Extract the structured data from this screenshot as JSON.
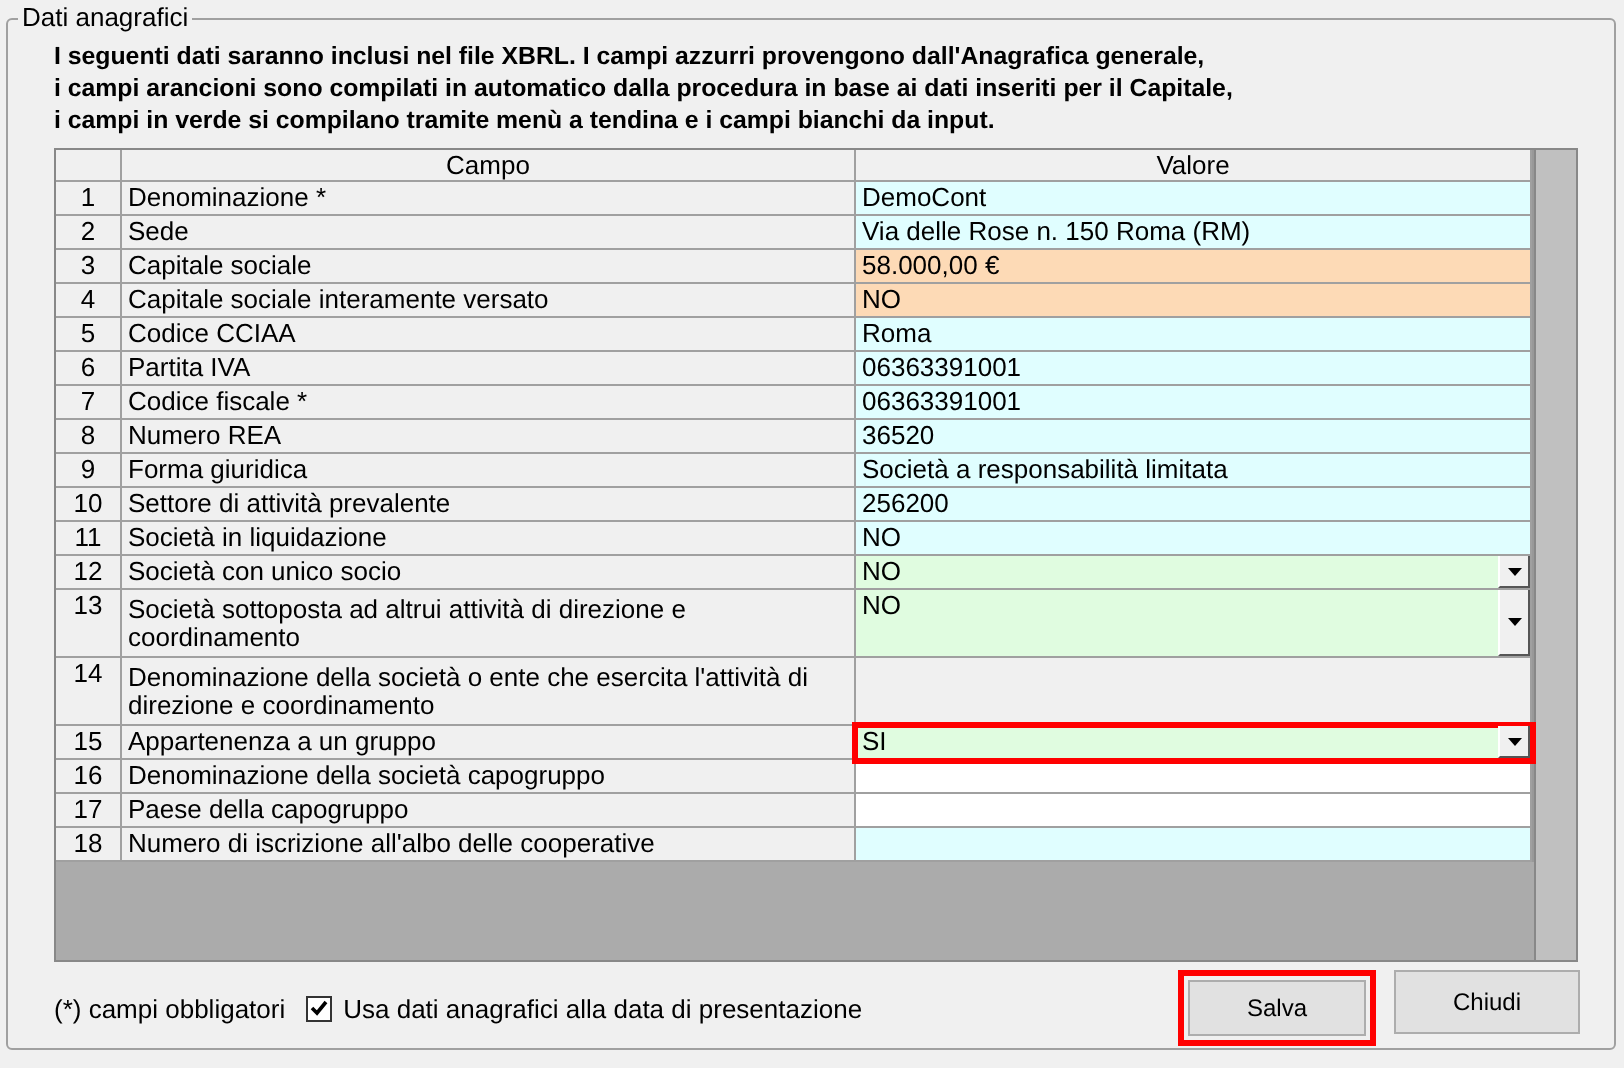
{
  "group_title": "Dati anagrafici",
  "intro": "I seguenti dati saranno inclusi nel file XBRL. I campi azzurri provengono dall'Anagrafica generale,\ni campi arancioni sono compilati in automatico dalla procedura in base ai dati inseriti per il Capitale,\ni campi in verde si compilano tramite menù a tendina e i campi bianchi da input.",
  "table": {
    "columns": [
      "Campo",
      "Valore"
    ],
    "rows": [
      {
        "number": "1",
        "field": "Denominazione *",
        "value": "DemoCont",
        "kind": "anagrafica",
        "highlighted": false
      },
      {
        "number": "2",
        "field": "Sede",
        "value": "Via delle Rose n. 150 Roma (RM)",
        "kind": "anagrafica",
        "highlighted": false
      },
      {
        "number": "3",
        "field": "Capitale sociale",
        "value": "58.000,00 €",
        "kind": "capitale",
        "highlighted": false
      },
      {
        "number": "4",
        "field": "Capitale sociale interamente versato",
        "value": "NO",
        "kind": "capitale",
        "highlighted": false
      },
      {
        "number": "5",
        "field": "Codice CCIAA",
        "value": "Roma",
        "kind": "anagrafica",
        "highlighted": false
      },
      {
        "number": "6",
        "field": "Partita IVA",
        "value": "06363391001",
        "kind": "anagrafica",
        "highlighted": false
      },
      {
        "number": "7",
        "field": "Codice fiscale *",
        "value": "06363391001",
        "kind": "anagrafica",
        "highlighted": false
      },
      {
        "number": "8",
        "field": "Numero REA",
        "value": "36520",
        "kind": "anagrafica",
        "highlighted": false
      },
      {
        "number": "9",
        "field": "Forma giuridica",
        "value": "Società a responsabilità limitata",
        "kind": "anagrafica",
        "highlighted": false
      },
      {
        "number": "10",
        "field": "Settore di attività prevalente",
        "value": "256200",
        "kind": "anagrafica",
        "highlighted": false
      },
      {
        "number": "11",
        "field": "Società in liquidazione",
        "value": "NO",
        "kind": "anagrafica",
        "highlighted": false
      },
      {
        "number": "12",
        "field": "Società con unico socio",
        "value": "NO",
        "kind": "dropdown",
        "highlighted": false
      },
      {
        "number": "13",
        "field": "Società sottoposta ad altrui attività di direzione e coordinamento",
        "value": "NO",
        "kind": "dropdown",
        "highlighted": false
      },
      {
        "number": "14",
        "field": "Denominazione della società o ente che esercita l'attività di direzione e coordinamento",
        "kind": "empty",
        "highlighted": false
      },
      {
        "number": "15",
        "field": "Appartenenza a un gruppo",
        "value": "SI",
        "kind": "dropdown",
        "highlighted": true
      },
      {
        "number": "16",
        "field": "Denominazione della società capogruppo",
        "kind": "input",
        "highlighted": false
      },
      {
        "number": "17",
        "field": "Paese della capogruppo",
        "kind": "input",
        "highlighted": false
      },
      {
        "number": "18",
        "field": "Numero di iscrizione all'albo delle cooperative",
        "kind": "anagrafica",
        "highlighted": false
      }
    ]
  },
  "footnote": "(*) campi obbligatori",
  "checkbox": {
    "label": "Usa dati anagrafici alla data di presentazione",
    "checked": true
  },
  "buttons": [
    {
      "label": "Salva",
      "highlighted": true
    },
    {
      "label": "Chiudi",
      "highlighted": false
    }
  ]
}
